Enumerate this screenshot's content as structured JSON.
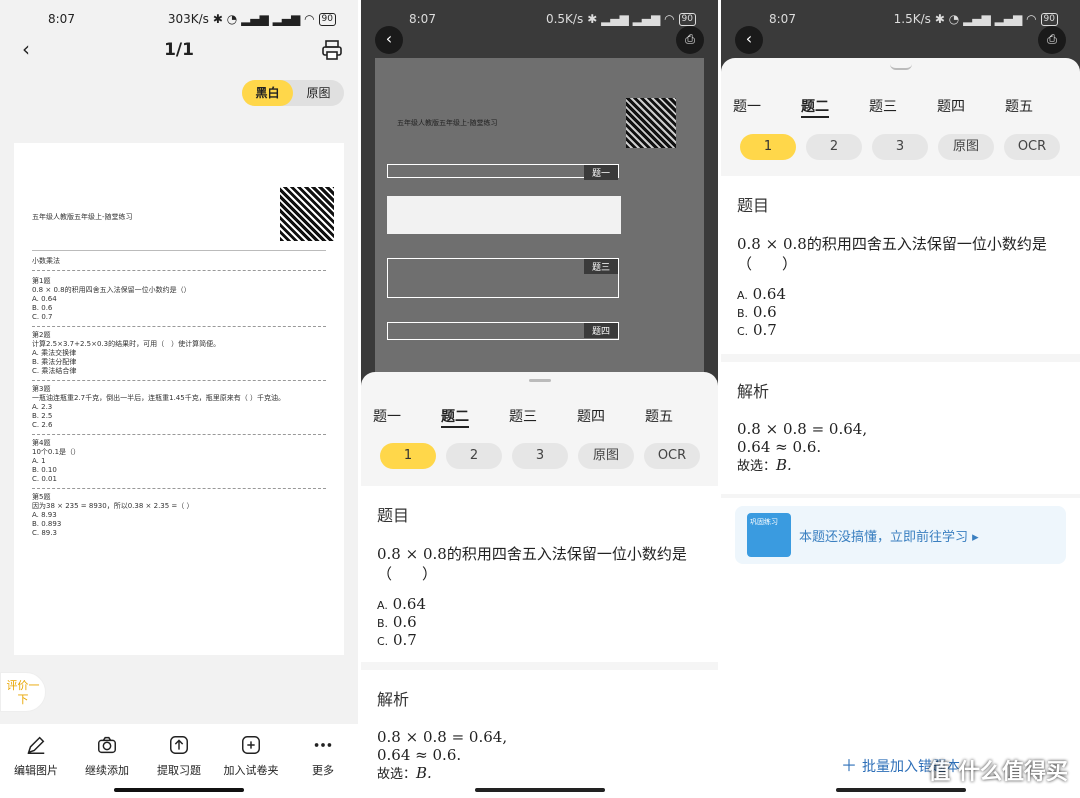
{
  "status_bar": {
    "left": {
      "time": "8:07",
      "net": "303K/s",
      "battery": "90"
    },
    "middle": {
      "time": "8:07",
      "net": "0.5K/s",
      "battery": "90"
    },
    "right": {
      "time": "8:07",
      "net": "1.5K/s",
      "battery": "90"
    }
  },
  "preview": {
    "page_title": "1/1",
    "toggle": {
      "bw": "黑白",
      "original": "原图"
    },
    "feedback": "评价一下",
    "document": {
      "header": "五年级人教版五年级上-随堂练习",
      "section": "小数乘法",
      "q1": {
        "label": "第1题",
        "text": "0.8 × 0.8的积用四舍五入法保留一位小数约是（）",
        "opts": [
          "A. 0.64",
          "B. 0.6",
          "C. 0.7"
        ]
      },
      "q2": {
        "label": "第2题",
        "text": "计算2.5×3.7+2.5×0.3的结果时，可用（　）使计算简便。",
        "opts": [
          "A. 乘法交换律",
          "B. 乘法分配律",
          "C. 乘法结合律"
        ]
      },
      "q3": {
        "label": "第3题",
        "text": "一瓶油连瓶重2.7千克，倒出一半后，连瓶重1.45千克，瓶里原来有（ ）千克油。",
        "opts": [
          "A. 2.3",
          "B. 2.5",
          "C. 2.6"
        ]
      },
      "q4": {
        "label": "第4题",
        "text": "10个0.1是（）",
        "opts": [
          "A. 1",
          "B. 0.10",
          "C. 0.01"
        ]
      },
      "q5": {
        "label": "第5题",
        "text": "因为38 × 235 = 8930，所以0.38 × 2.35 =（ ）",
        "opts": [
          "A. 8.93",
          "B. 0.893",
          "C. 89.3"
        ]
      }
    },
    "toolbar": [
      "编辑图片",
      "继续添加",
      "提取习题",
      "加入试卷夹",
      "更多"
    ]
  },
  "scan_overlay": {
    "boxes": [
      "题一",
      "题三",
      "题四"
    ]
  },
  "question_tabs": [
    "题一",
    "题二",
    "题三",
    "题四",
    "题五"
  ],
  "chips": [
    "1",
    "2",
    "3",
    "原图",
    "OCR"
  ],
  "question": {
    "heading": "题目",
    "text": "0.8 × 0.8的积用四舍五入法保留一位小数约是（　　）",
    "options": [
      {
        "letter": "A.",
        "value": "0.64"
      },
      {
        "letter": "B.",
        "value": "0.6"
      },
      {
        "letter": "C.",
        "value": "0.7"
      }
    ]
  },
  "analysis": {
    "heading": "解析",
    "line1": "0.8 × 0.8 = 0.64,",
    "line2": "0.64 ≈ 0.6.",
    "line3_prefix": "故选：",
    "line3_answer": "B."
  },
  "promo": {
    "thumb_label": "巩固练习",
    "text": "本题还没搞懂，立即前往学习 ▸"
  },
  "batch_add": "批量加入错题本",
  "watermark": "值 什么值得买",
  "colors": {
    "accent": "#ffd74a",
    "promo_blue": "#3a9be0"
  }
}
